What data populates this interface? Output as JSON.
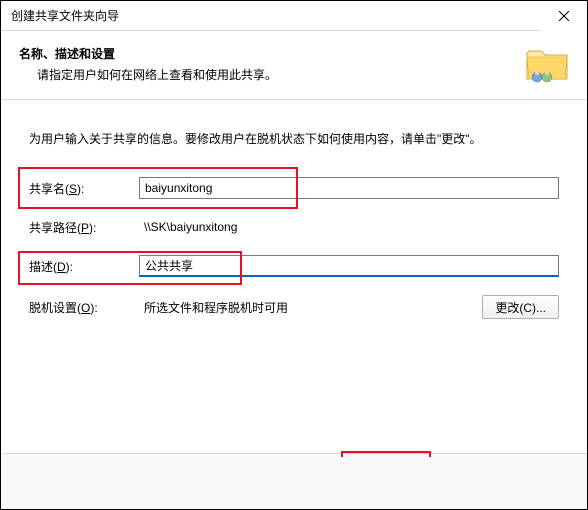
{
  "window": {
    "title": "创建共享文件夹向导"
  },
  "header": {
    "title": "名称、描述和设置",
    "subtitle": "请指定用户如何在网络上查看和使用此共享。"
  },
  "content": {
    "intro": "为用户输入关于共享的信息。要修改用户在脱机状态下如何使用内容，请单击\"更改\"。"
  },
  "fields": {
    "share_name": {
      "label_prefix": "共享名(",
      "label_key": "S",
      "label_suffix": "):",
      "value": "baiyunxitong"
    },
    "share_path": {
      "label_prefix": "共享路径(",
      "label_key": "P",
      "label_suffix": "):",
      "value": "\\\\SK\\baiyunxitong"
    },
    "description": {
      "label_prefix": "描述(",
      "label_key": "D",
      "label_suffix": "):",
      "value": "公共共享"
    },
    "offline": {
      "label_prefix": "脱机设置(",
      "label_key": "O",
      "label_suffix": "):",
      "value": "所选文件和程序脱机时可用"
    }
  },
  "buttons": {
    "change": "更改(C)..."
  }
}
